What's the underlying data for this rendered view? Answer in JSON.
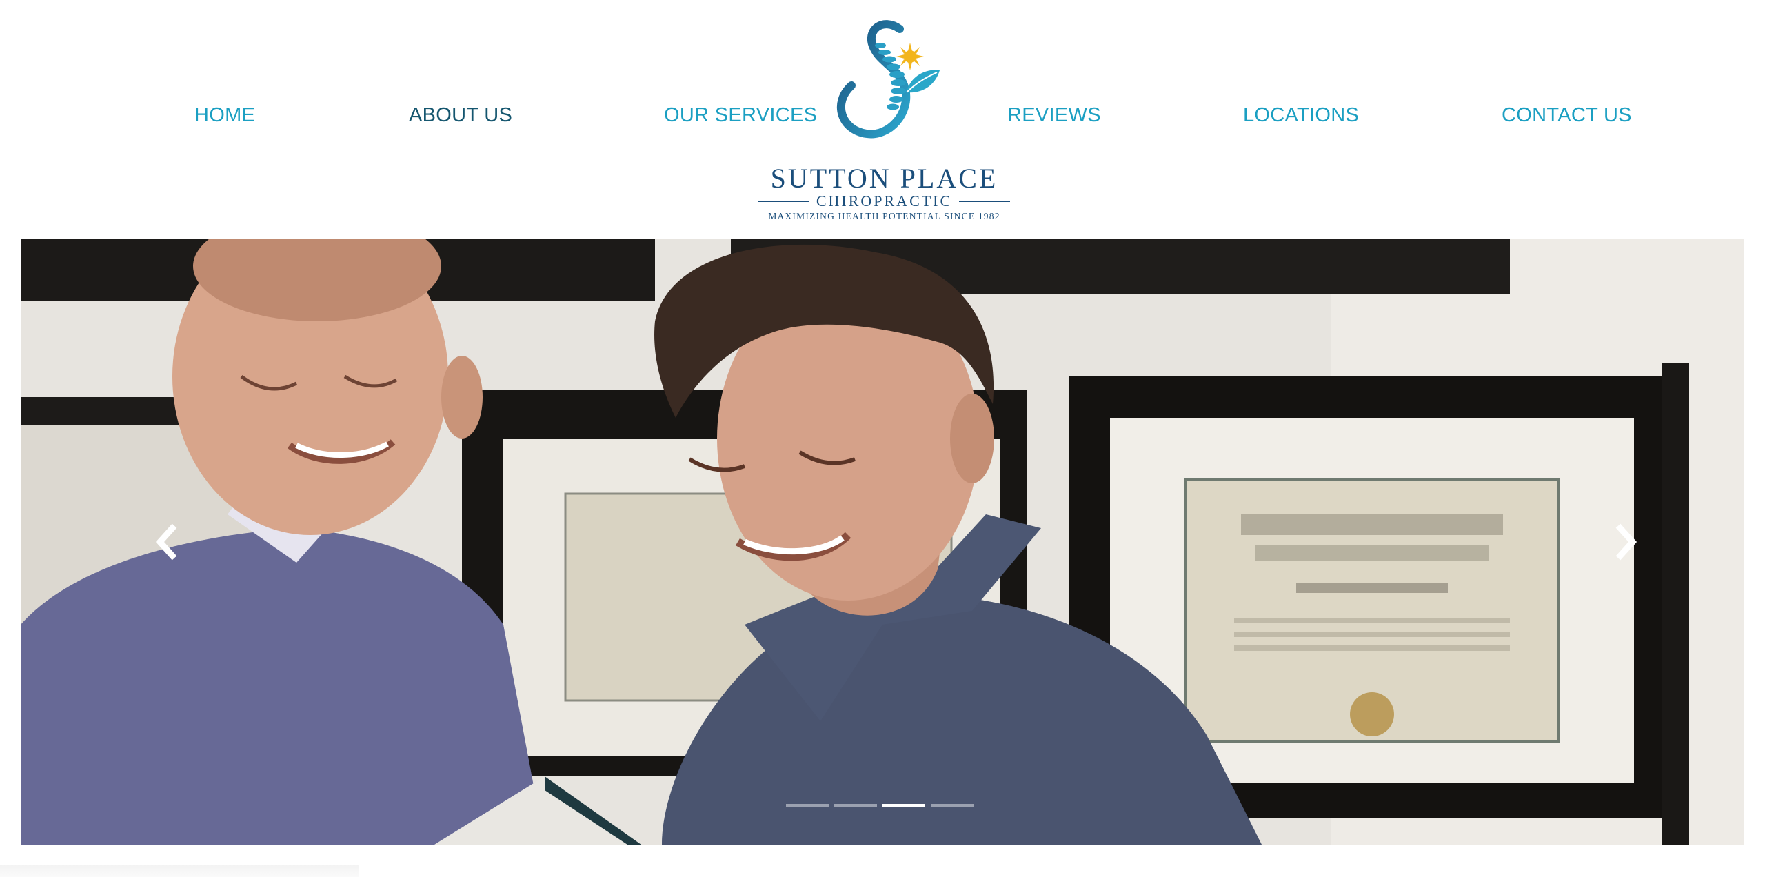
{
  "nav": {
    "items": [
      {
        "label": "HOME"
      },
      {
        "label": "ABOUT US"
      },
      {
        "label": "OUR SERVICES"
      },
      {
        "label": "REVIEWS"
      },
      {
        "label": "LOCATIONS"
      },
      {
        "label": "CONTACT US"
      }
    ],
    "active_index": 1
  },
  "logo": {
    "name": "SUTTON PLACE",
    "subtitle": "CHIROPRACTIC",
    "tagline": "MAXIMIZING HEALTH POTENTIAL SINCE 1982",
    "icon": "spine-with-sun-and-leaf-icon"
  },
  "carousel": {
    "slide_count": 4,
    "active_slide_index": 2,
    "prev_icon": "chevron-left-icon",
    "next_icon": "chevron-right-icon",
    "image_content": "two-smiling-men-in-front-of-framed-diplomas"
  },
  "colors": {
    "nav_link": "#1b9fc2",
    "nav_active": "#15566f",
    "logo_navy": "#1b4e7b",
    "logo_teal": "#2a8fb3",
    "sun_yellow": "#f2b51c"
  }
}
